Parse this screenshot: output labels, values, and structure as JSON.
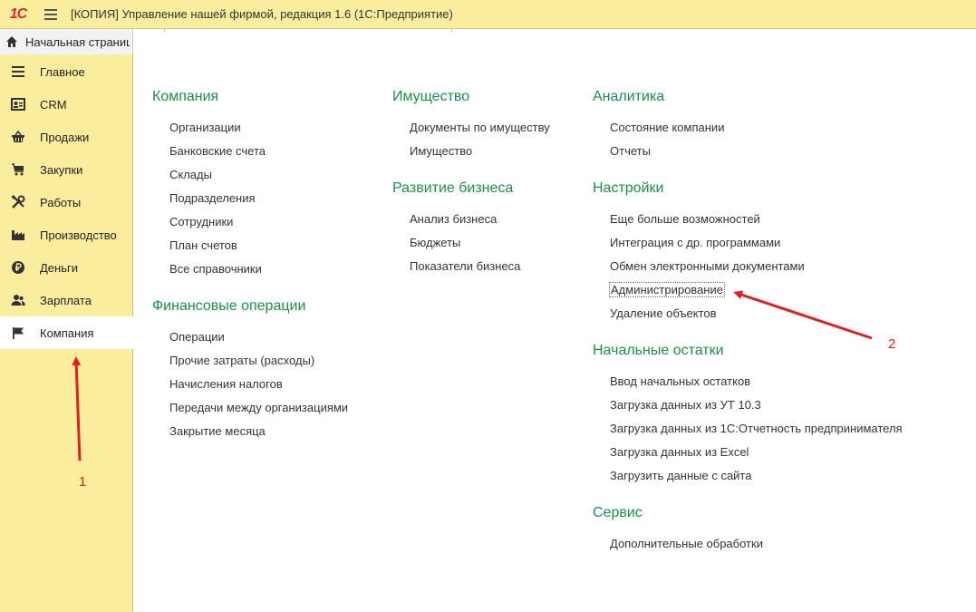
{
  "app": {
    "logo_text": "1С",
    "title": "[КОПИЯ] Управление нашей фирмой, редакция 1.6  (1С:Предприятие)"
  },
  "tabs": {
    "home_label": "Начальная страница"
  },
  "sidebar": {
    "items": [
      {
        "label": "Главное",
        "icon": "list-icon"
      },
      {
        "label": "CRM",
        "icon": "contact-card-icon"
      },
      {
        "label": "Продажи",
        "icon": "basket-icon"
      },
      {
        "label": "Закупки",
        "icon": "cart-icon"
      },
      {
        "label": "Работы",
        "icon": "tools-icon"
      },
      {
        "label": "Производство",
        "icon": "factory-icon"
      },
      {
        "label": "Деньги",
        "icon": "ruble-icon"
      },
      {
        "label": "Зарплата",
        "icon": "people-icon"
      },
      {
        "label": "Компания",
        "icon": "flag-icon",
        "active": true
      }
    ]
  },
  "sections": {
    "company": {
      "title": "Компания",
      "links": [
        "Организации",
        "Банковские счета",
        "Склады",
        "Подразделения",
        "Сотрудники",
        "План счетов",
        "Все справочники"
      ]
    },
    "financial_ops": {
      "title": "Финансовые операции",
      "links": [
        "Операции",
        "Прочие затраты (расходы)",
        "Начисления налогов",
        "Передачи между организациями",
        "Закрытие месяца"
      ]
    },
    "property": {
      "title": "Имущество",
      "links": [
        "Документы по имуществу",
        "Имущество"
      ]
    },
    "business_dev": {
      "title": "Развитие бизнеса",
      "links": [
        "Анализ бизнеса",
        "Бюджеты",
        "Показатели бизнеса"
      ]
    },
    "analytics": {
      "title": "Аналитика",
      "links": [
        "Состояние компании",
        "Отчеты"
      ]
    },
    "settings": {
      "title": "Настройки",
      "links": [
        "Еще больше возможностей",
        "Интеграция с др. программами",
        "Обмен электронными документами",
        "Администрирование",
        "Удаление объектов"
      ]
    },
    "initial_balances": {
      "title": "Начальные остатки",
      "links": [
        "Ввод начальных остатков",
        "Загрузка данных из УТ 10.3",
        "Загрузка данных из 1С:Отчетность предпринимателя",
        "Загрузка данных из Excel",
        "Загрузить данные с сайта"
      ]
    },
    "service": {
      "title": "Сервис",
      "links": [
        "Дополнительные обработки"
      ]
    }
  },
  "annotations": {
    "marker_1": "1",
    "marker_2": "2",
    "color": "#e02020"
  },
  "colors": {
    "sidebar_bg": "#fbed9e",
    "group_title": "#1f8d4a"
  }
}
